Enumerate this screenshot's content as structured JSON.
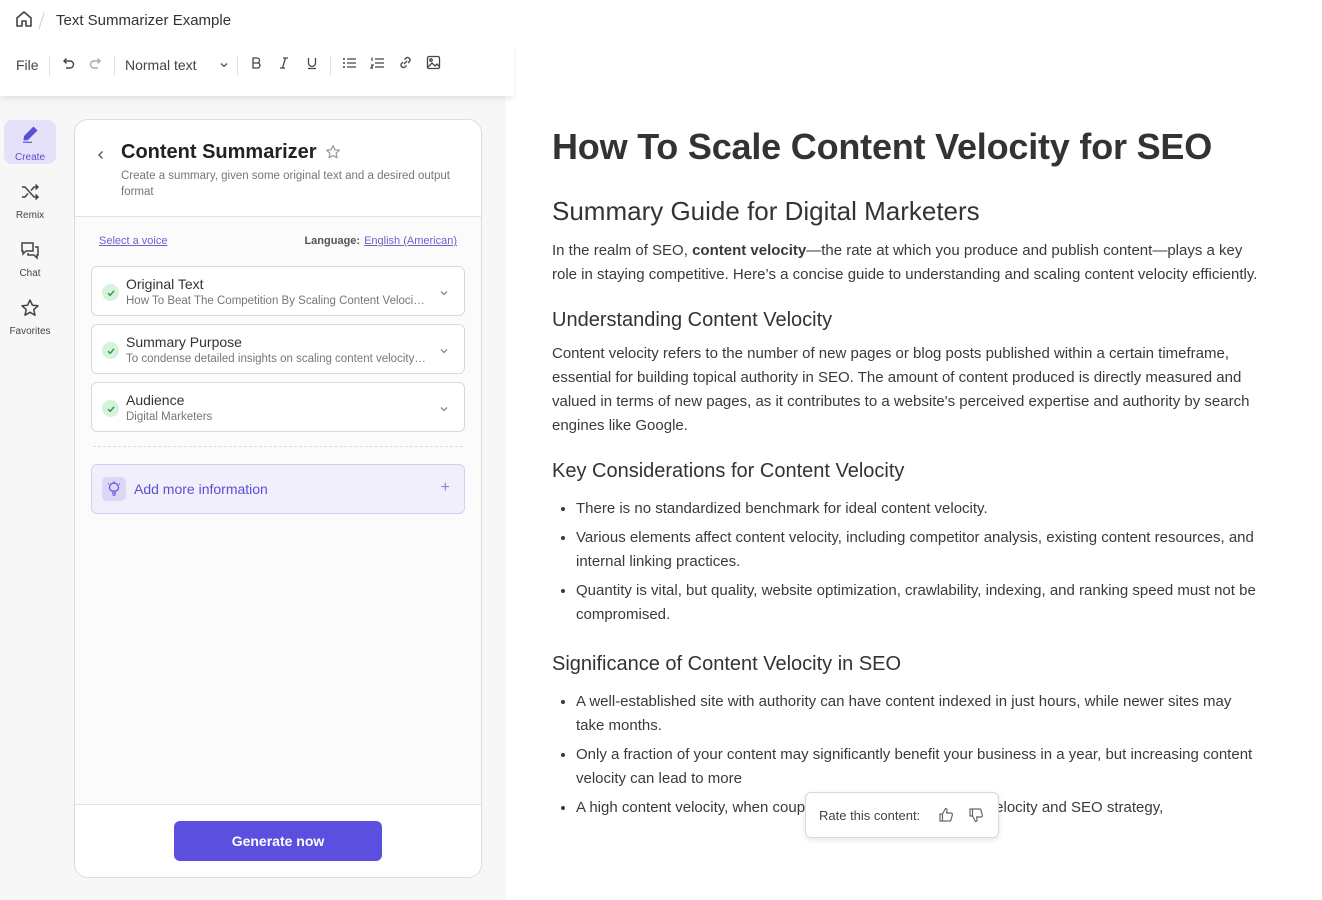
{
  "header": {
    "doc_title": "Text Summarizer Example",
    "home_icon": "home-icon"
  },
  "toolbar": {
    "file_label": "File",
    "style_label": "Normal text",
    "icons": [
      "undo-icon",
      "redo-icon",
      "chevron-down-icon",
      "bold-icon",
      "italic-icon",
      "underline-icon",
      "bullet-list-icon",
      "numbered-list-icon",
      "link-icon",
      "image-icon"
    ]
  },
  "rail": {
    "items": [
      {
        "label": "Create",
        "icon": "pen-icon",
        "active": true
      },
      {
        "label": "Remix",
        "icon": "shuffle-icon",
        "active": false
      },
      {
        "label": "Chat",
        "icon": "chat-icon",
        "active": false
      },
      {
        "label": "Favorites",
        "icon": "star-icon",
        "active": false
      }
    ]
  },
  "panel": {
    "title": "Content Summarizer",
    "description": "Create a summary, given some original text and a desired output format",
    "voice_link": "Select a voice",
    "language_label": "Language:",
    "language_value": "English (American)",
    "fields": [
      {
        "label": "Original Text",
        "value": "How To Beat The Competition By Scaling Content Velocity for SEO"
      },
      {
        "label": "Summary Purpose",
        "value": "To condense detailed insights on scaling content velocity for SEO"
      },
      {
        "label": "Audience",
        "value": "Digital Marketers"
      }
    ],
    "add_info_label": "Add more information",
    "add_info_plus": "+",
    "generate_label": "Generate now"
  },
  "document": {
    "h1": "How To Scale Content Velocity for SEO",
    "h2": "Summary Guide for Digital Marketers",
    "intro_before": "In the realm of SEO, ",
    "intro_bold": "content velocity",
    "intro_after": "—the rate at which you produce and publish content—plays a key role in staying competitive. Here’s a concise guide to understanding and scaling content velocity efficiently.",
    "sections": [
      {
        "heading": "Understanding Content Velocity",
        "paragraph": "Content velocity refers to the number of new pages or blog posts published within a certain timeframe, essential for building topical authority in SEO. The amount of content produced is directly measured and valued in terms of new pages, as it contributes to a website's perceived expertise and authority by search engines like Google."
      },
      {
        "heading": "Key Considerations for Content Velocity",
        "bullets": [
          "There is no standardized benchmark for ideal content velocity.",
          "Various elements affect content velocity, including competitor analysis, existing content resources, and internal linking practices.",
          "Quantity is vital, but quality, website optimization, crawlability, indexing, and ranking speed must not be compromised."
        ]
      },
      {
        "heading": "Significance of Content Velocity in SEO",
        "bullets": [
          "A well-established site with authority can have content indexed in just hours, while newer sites may take months.",
          "Only a fraction of your content may significantly benefit your business in a year, but increasing content velocity can lead to more",
          "A high content velocity, when coupled with an appropriate link velocity and SEO strategy,"
        ]
      }
    ]
  },
  "rating": {
    "label": "Rate this content:",
    "up_icon": "thumbs-up-icon",
    "down_icon": "thumbs-down-icon"
  },
  "colors": {
    "accent": "#5b4fe0",
    "check_green": "#3fb950",
    "rail_bg": "#f7f7f7"
  }
}
